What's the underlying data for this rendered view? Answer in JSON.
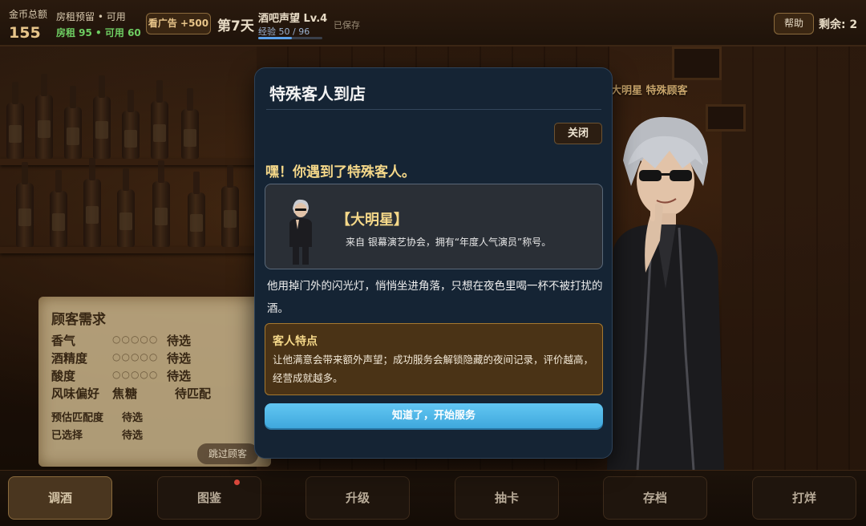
{
  "hud": {
    "gold_label": "金币总额",
    "gold_value": "155",
    "rent_title": "房租预留 • 可用",
    "rent_values": "房租 95 • 可用 60",
    "ad_button": "看广告 +500",
    "day": "第7天",
    "reputation_title": "酒吧声望 Lv.4",
    "reputation_exp": "经验 50 / 96",
    "reputation_progress": 0.52,
    "saved_status": "已保存",
    "help_button": "帮助",
    "remaining": "剩余: 2"
  },
  "guest_tag": "大明星 特殊顾客",
  "order": {
    "title": "顾客需求",
    "rows": [
      {
        "label": "香气",
        "dots": "○○○○○",
        "value": "待选"
      },
      {
        "label": "酒精度",
        "dots": "○○○○○",
        "value": "待选"
      },
      {
        "label": "酸度",
        "dots": "○○○○○",
        "value": "待选"
      },
      {
        "label": "风味偏好",
        "dots": "焦糖",
        "value": "待匹配"
      }
    ],
    "match_label": "预估匹配度",
    "match_value": "待选",
    "selected_label": "已选择",
    "selected_value": "待选",
    "skip_button": "跳过顾客"
  },
  "modal": {
    "title": "特殊客人到店",
    "close_button": "关闭",
    "headline": "嘿！你遇到了特殊客人。",
    "guest_name": "【大明星】",
    "guest_desc": "来自 银幕演艺协会，拥有“年度人气演员”称号。",
    "story": "他用掉门外的闪光灯，悄悄坐进角落，只想在夜色里喝一杯不被打扰的酒。",
    "trait_title": "客人特点",
    "trait_body": "让他满意会带来额外声望；成功服务会解锁隐藏的夜间记录，评价越高，经营成就越多。",
    "start_button": "知道了，开始服务"
  },
  "nav": {
    "items": [
      {
        "label": "调酒",
        "active": true
      },
      {
        "label": "图鉴",
        "active": false,
        "has_dot": true
      },
      {
        "label": "升级",
        "active": false
      },
      {
        "label": "抽卡",
        "active": false
      },
      {
        "label": "存档",
        "active": false
      },
      {
        "label": "打烊",
        "active": false
      }
    ]
  },
  "colors": {
    "accent_gold": "#f5d889",
    "rent_green": "#6fcf63",
    "modal_bg": "#152434",
    "start_button": "#4fb8e8",
    "notification_dot": "#d9483c"
  }
}
